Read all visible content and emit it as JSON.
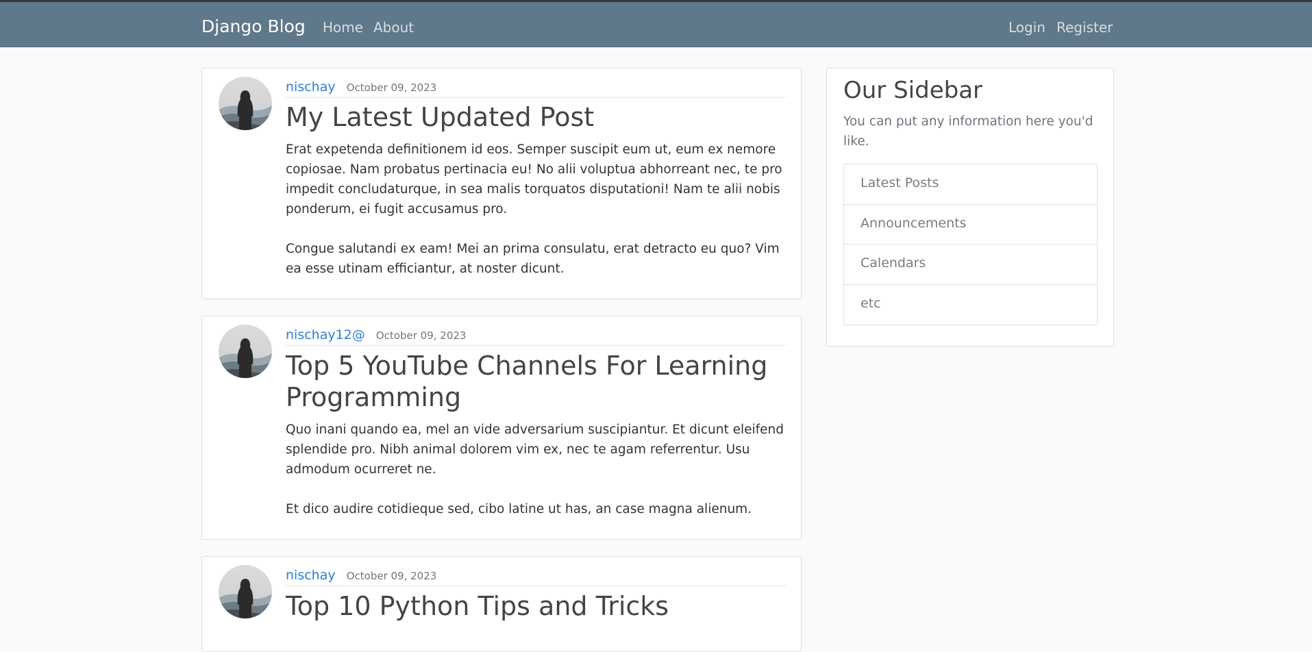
{
  "navbar": {
    "brand": "Django Blog",
    "left_links": [
      "Home",
      "About"
    ],
    "right_links": [
      "Login",
      "Register"
    ],
    "background": "#5f788a"
  },
  "posts": [
    {
      "author": "nischay",
      "date": "October 09, 2023",
      "title": "My Latest Updated Post",
      "content": "Erat expetenda definitionem id eos. Semper suscipit eum ut, eum ex nemore copiosae. Nam probatus pertinacia eu! No alii voluptua abhorreant nec, te pro impedit concludaturque, in sea malis torquatos disputationi! Nam te alii nobis ponderum, ei fugit accusamus pro.\n\nCongue salutandi ex eam! Mei an prima consulatu, erat detracto eu quo? Vim ea esse utinam efficiantur, at noster dicunt."
    },
    {
      "author": "nischay12@",
      "date": "October 09, 2023",
      "title": "Top 5 YouTube Channels For Learning Programming",
      "content": "Quo inani quando ea, mel an vide adversarium suscipiantur. Et dicunt eleifend splendide pro. Nibh animal dolorem vim ex, nec te agam referrentur. Usu admodum ocurreret ne.\n\nEt dico audire cotidieque sed, cibo latine ut has, an case magna alienum."
    },
    {
      "author": "nischay",
      "date": "October 09, 2023",
      "title": "Top 10 Python Tips and Tricks"
    }
  ],
  "sidebar": {
    "title": "Our Sidebar",
    "text": "You can put any information here you'd like.",
    "items": [
      "Latest Posts",
      "Announcements",
      "Calendars",
      "etc"
    ]
  },
  "colors": {
    "author_link": "#2a7fd4",
    "page_background": "#fafafa"
  }
}
